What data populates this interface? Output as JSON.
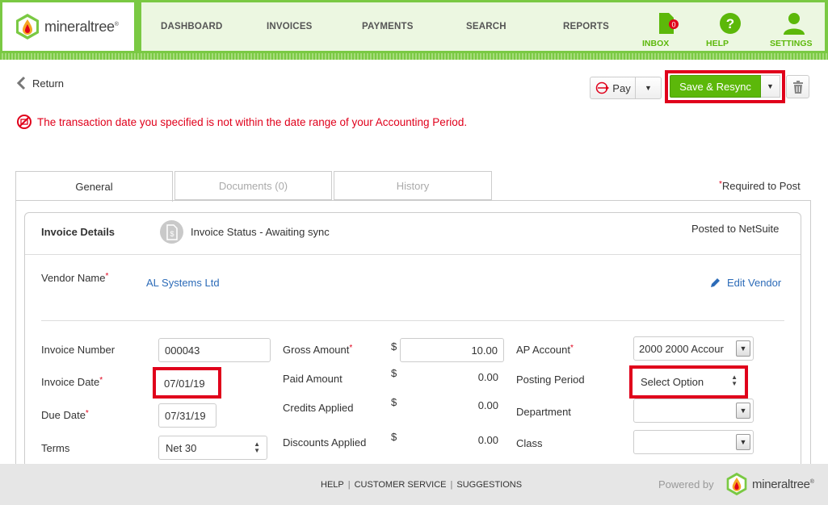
{
  "brand": {
    "name": "mineraltree",
    "trademark": "®"
  },
  "nav": {
    "dashboard": "DASHBOARD",
    "invoices": "INVOICES",
    "payments": "PAYMENTS",
    "search": "SEARCH",
    "reports": "REPORTS",
    "inbox": "INBOX",
    "inbox_badge": "0",
    "help": "HELP",
    "settings": "SETTINGS"
  },
  "actions": {
    "return_label": "Return",
    "pay_label": "Pay",
    "save_resync_label": "Save & Resync"
  },
  "error_message": "The transaction date you specified is not within the date range of your Accounting Period.",
  "tabs": {
    "general": "General",
    "documents": "Documents (0)",
    "history": "History"
  },
  "required_note": "Required to Post",
  "invoice": {
    "section_title": "Invoice Details",
    "status": "Invoice Status - Awaiting sync",
    "posted": "Posted to NetSuite",
    "vendor_label": "Vendor Name",
    "vendor_value": "AL Systems Ltd",
    "edit_vendor": "Edit Vendor",
    "invoice_number_label": "Invoice Number",
    "invoice_number": "000043",
    "invoice_date_label": "Invoice Date",
    "invoice_date": "07/01/19",
    "due_date_label": "Due Date",
    "due_date": "07/31/19",
    "terms_label": "Terms",
    "terms": "Net 30",
    "gross_amount_label": "Gross Amount",
    "gross_amount": "10.00",
    "paid_amount_label": "Paid Amount",
    "paid_amount": "0.00",
    "credits_applied_label": "Credits Applied",
    "credits_applied": "0.00",
    "discounts_applied_label": "Discounts Applied",
    "discounts_applied": "0.00",
    "currency": "$",
    "ap_account_label": "AP Account",
    "ap_account": "2000 2000 Accour",
    "posting_period_label": "Posting Period",
    "posting_period": "Select Option",
    "department_label": "Department",
    "department": "",
    "class_label": "Class",
    "class": ""
  },
  "footer": {
    "help": "HELP",
    "customer_service": "CUSTOMER SERVICE",
    "suggestions": "SUGGESTIONS",
    "powered_by": "Powered by",
    "separator": "|"
  },
  "colors": {
    "brand_green": "#7ac943",
    "button_green": "#5cb80a",
    "error_red": "#e0001b",
    "link_blue": "#2c6bb8"
  },
  "icons": [
    "logo-drop-icon",
    "inbox-icon",
    "help-icon",
    "settings-user-icon",
    "chevron-left-icon",
    "pay-cycle-icon",
    "caret-down-icon",
    "trash-icon",
    "error-icon",
    "document-dollar-icon",
    "pencil-icon"
  ]
}
